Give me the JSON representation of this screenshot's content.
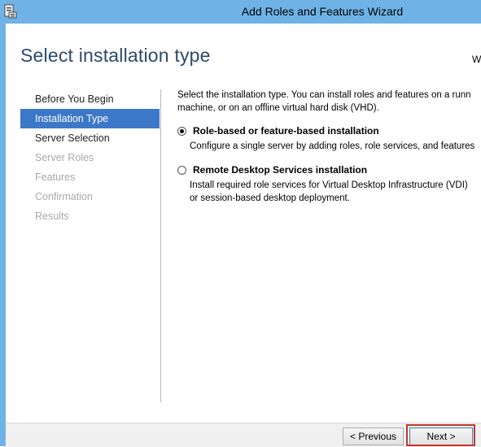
{
  "window": {
    "title": "Add Roles and Features Wizard"
  },
  "page": {
    "title": "Select installation type",
    "destination_server": "W"
  },
  "nav": {
    "items": [
      {
        "label": "Before You Begin"
      },
      {
        "label": "Installation Type"
      },
      {
        "label": "Server Selection"
      },
      {
        "label": "Server Roles"
      },
      {
        "label": "Features"
      },
      {
        "label": "Confirmation"
      },
      {
        "label": "Results"
      }
    ]
  },
  "content": {
    "intro_line1": "Select the installation type. You can install roles and features on a runn",
    "intro_line2": "machine, or on an offline virtual hard disk (VHD).",
    "options": [
      {
        "label": "Role-based or feature-based installation",
        "desc_line1": "Configure a single server by adding roles, role services, and features",
        "desc_line2": "",
        "selected": true
      },
      {
        "label": "Remote Desktop Services installation",
        "desc_line1": "Install required role services for Virtual Desktop Infrastructure (VDI)",
        "desc_line2": "or session-based desktop deployment.",
        "selected": false
      }
    ]
  },
  "buttons": {
    "previous": "< Previous",
    "next": "Next >"
  }
}
